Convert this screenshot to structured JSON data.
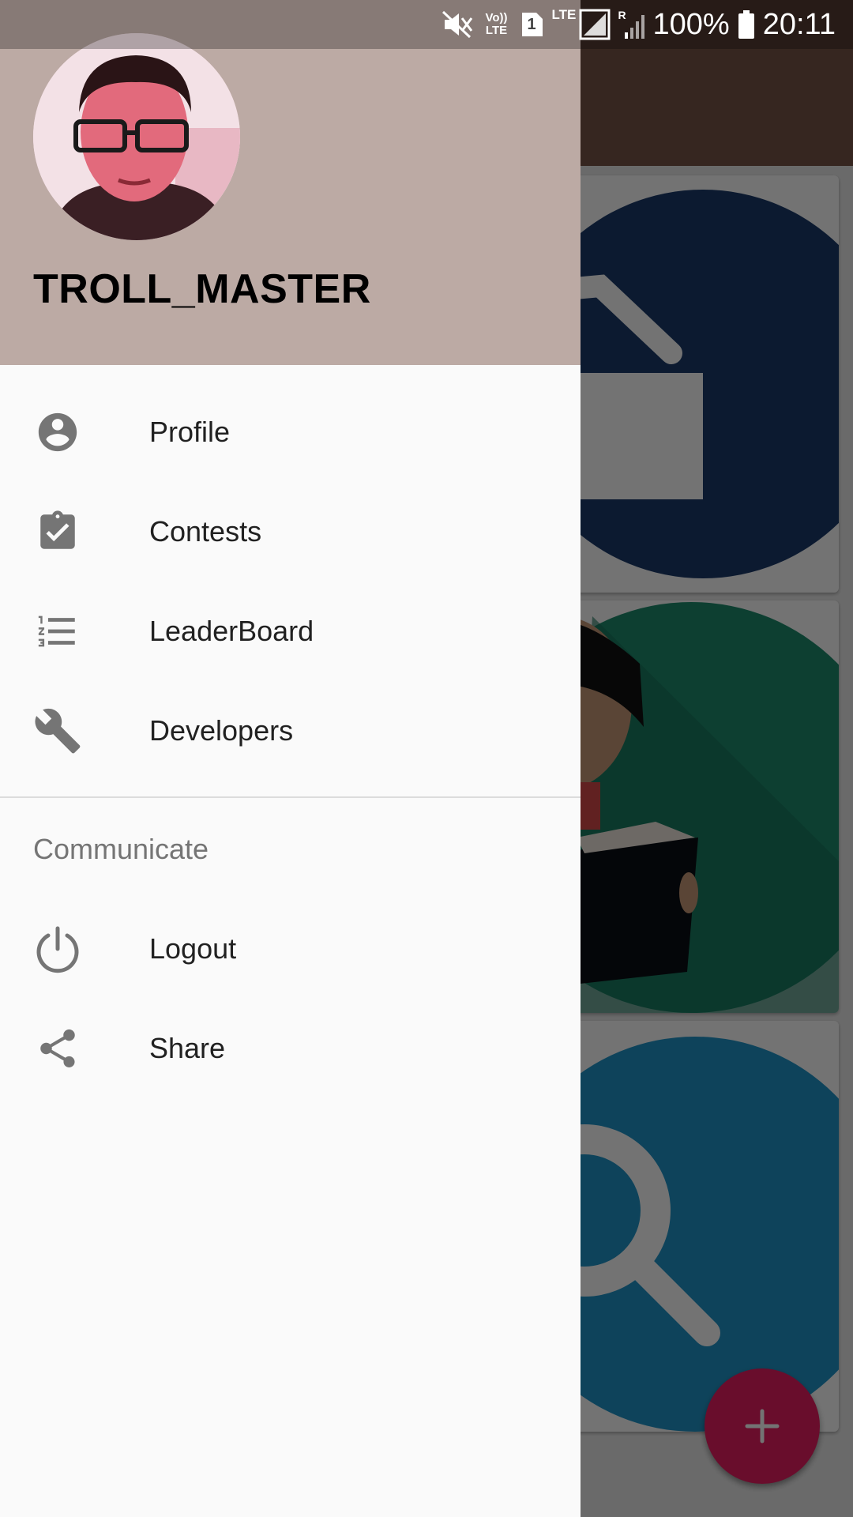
{
  "status_bar": {
    "volte_label": "Vo))\nLTE",
    "sim_label": "1",
    "lte_label": "LTE",
    "roaming_label": "R",
    "battery": "100%",
    "time": "20:11",
    "icons": [
      "mute-icon",
      "volte-icon",
      "sim-icon",
      "signal-icon",
      "signal-roaming-icon",
      "battery-icon"
    ]
  },
  "drawer": {
    "header": {
      "username": "TROLL_MASTER",
      "background_color": "#bcaaa4"
    },
    "items": [
      {
        "label": "Profile",
        "icon": "account-circle-icon"
      },
      {
        "label": "Contests",
        "icon": "clipboard-check-icon"
      },
      {
        "label": "LeaderBoard",
        "icon": "format-list-numbered-icon"
      },
      {
        "label": "Developers",
        "icon": "wrench-icon"
      }
    ],
    "section": {
      "title": "Communicate",
      "items": [
        {
          "label": "Logout",
          "icon": "power-icon"
        },
        {
          "label": "Share",
          "icon": "share-icon"
        }
      ]
    }
  },
  "background_app": {
    "toolbar_color": "#795548",
    "fab_icon": "plus-icon",
    "fab_color": "#e91e63",
    "cards": [
      {
        "icon": "inbox-icon",
        "color": "#1b3a6b"
      },
      {
        "icon": "reader-icon",
        "color": "#1e8c6e"
      },
      {
        "icon": "search-icon",
        "color": "#2196c9"
      }
    ]
  }
}
